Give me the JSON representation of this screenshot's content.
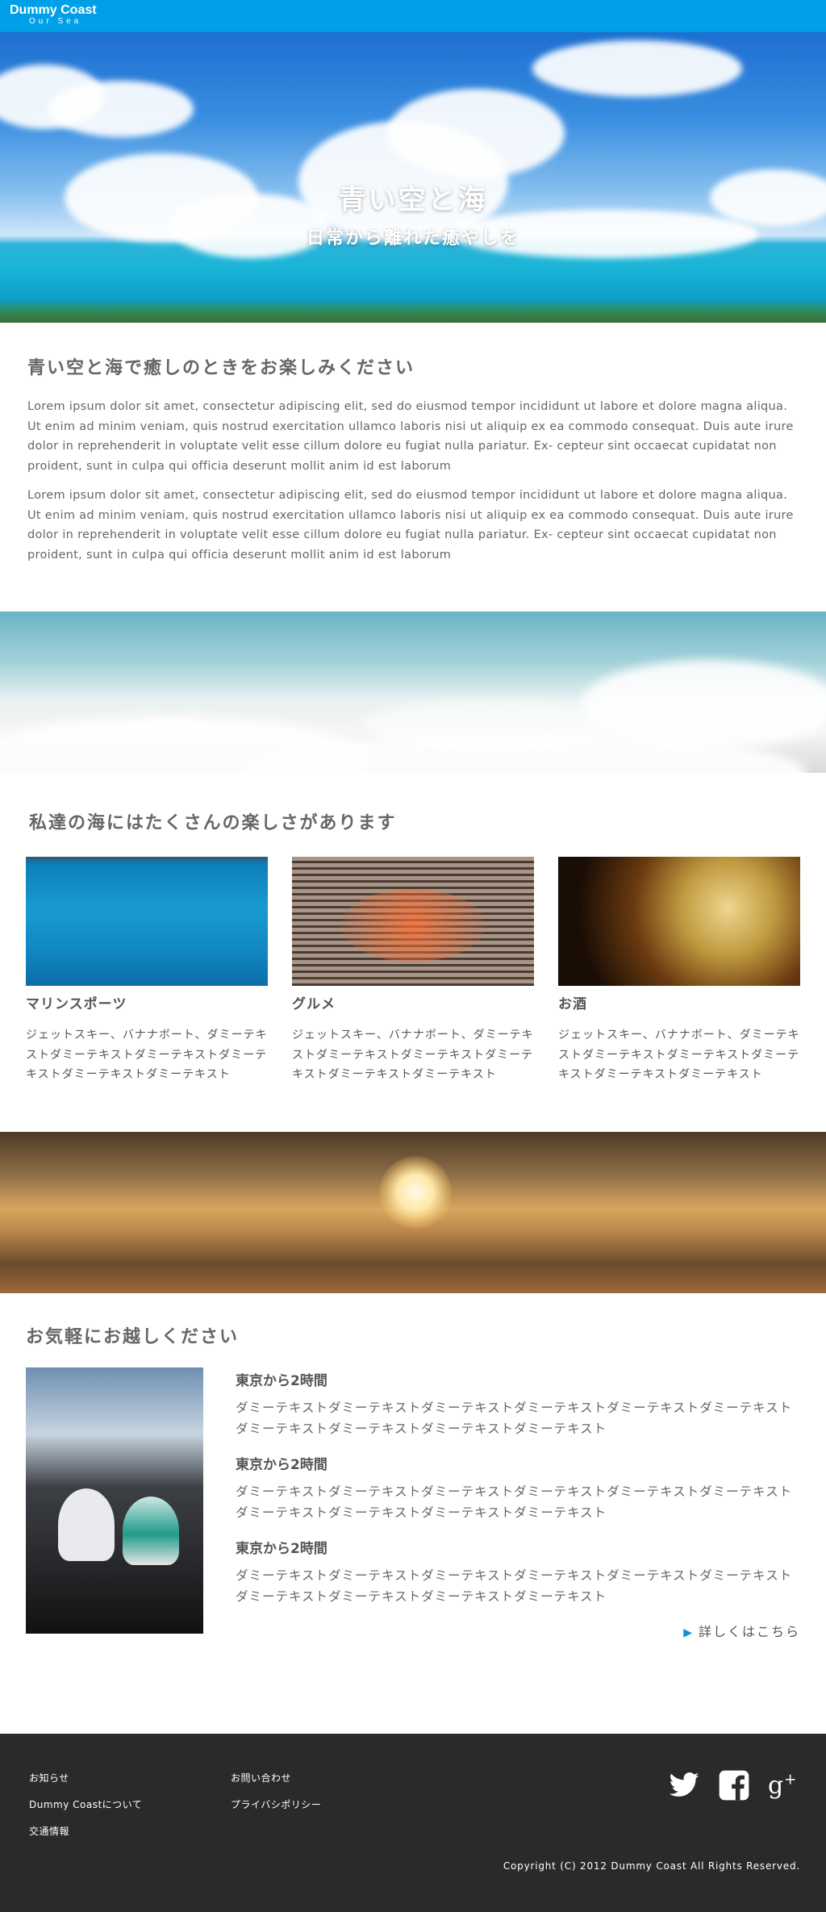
{
  "header": {
    "logo_title": "Dummy Coast",
    "logo_sub": "Our Sea",
    "bg_color": "#00a0e9"
  },
  "hero": {
    "title": "青い空と海",
    "subtitle": "日常から離れた癒やしを"
  },
  "intro": {
    "heading": "青い空と海で癒しのときをお楽しみください",
    "paragraphs": [
      "Lorem ipsum dolor sit amet, consectetur adipiscing elit, sed do eiusmod tempor incididunt ut labore et dolore magna aliqua. Ut enim ad minim veniam, quis nostrud exercitation ullamco laboris nisi ut aliquip ex ea commodo consequat. Duis aute irure dolor in reprehenderit in voluptate velit esse cillum dolore eu fugiat nulla pariatur. Ex- cepteur sint occaecat cupidatat non proident, sunt in culpa qui officia deserunt mollit anim id est laborum",
      "Lorem ipsum dolor sit amet, consectetur adipiscing elit, sed do eiusmod tempor incididunt ut labore et dolore magna aliqua. Ut enim ad minim veniam, quis nostrud exercitation ullamco laboris nisi ut aliquip ex ea commodo consequat. Duis aute irure dolor in reprehenderit in voluptate velit esse cillum dolore eu fugiat nulla pariatur. Ex- cepteur sint occaecat cupidatat non proident, sunt in culpa qui officia deserunt mollit anim id est laborum"
    ]
  },
  "features": {
    "heading": "私達の海にはたくさんの楽しさがあります",
    "cards": [
      {
        "title": "マリンスポーツ",
        "text": "ジェットスキー、バナナボート、ダミーテキストダミーテキストダミーテキストダミーテキストダミーテキストダミーテキスト"
      },
      {
        "title": "グルメ",
        "text": "ジェットスキー、バナナボート、ダミーテキストダミーテキストダミーテキストダミーテキストダミーテキストダミーテキスト"
      },
      {
        "title": "お酒",
        "text": "ジェットスキー、バナナボート、ダミーテキストダミーテキストダミーテキストダミーテキストダミーテキストダミーテキスト"
      }
    ]
  },
  "access": {
    "heading": "お気軽にお越しください",
    "items": [
      {
        "title": "東京から2時間",
        "text": "ダミーテキストダミーテキストダミーテキストダミーテキストダミーテキストダミーテキストダミーテキストダミーテキストダミーテキストダミーテキスト"
      },
      {
        "title": "東京から2時間",
        "text": "ダミーテキストダミーテキストダミーテキストダミーテキストダミーテキストダミーテキストダミーテキストダミーテキストダミーテキストダミーテキスト"
      },
      {
        "title": "東京から2時間",
        "text": "ダミーテキストダミーテキストダミーテキストダミーテキストダミーテキストダミーテキストダミーテキストダミーテキストダミーテキストダミーテキスト"
      }
    ],
    "more_link": "詳しくはこちら"
  },
  "footer": {
    "links": [
      "お知らせ",
      "お問い合わせ",
      "Dummy Coastについて",
      "プライバシポリシー",
      "交通情報"
    ],
    "social_icons": [
      "twitter-icon",
      "facebook-icon",
      "google-plus-icon"
    ],
    "copyright": "Copyright (C) 2012 Dummy Coast All Rights Reserved.",
    "bg_color": "#2a2a2a"
  }
}
